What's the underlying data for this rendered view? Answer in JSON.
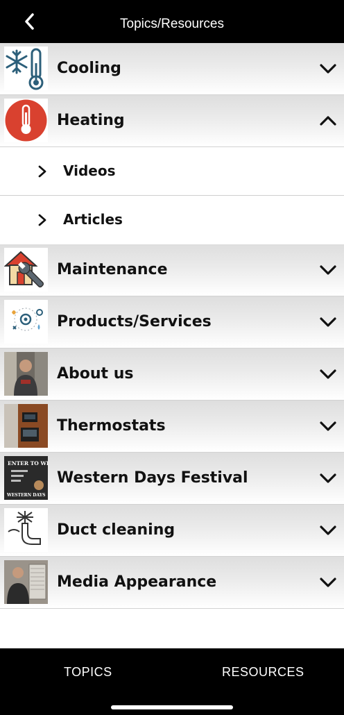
{
  "header": {
    "title": "Topics/Resources",
    "back_icon": "chevron-left-icon"
  },
  "topics": [
    {
      "key": "cooling",
      "label": "Cooling",
      "thumb": "snowflake-thermometer-icon",
      "expanded": false
    },
    {
      "key": "heating",
      "label": "Heating",
      "thumb": "thermometer-icon",
      "expanded": true,
      "children": [
        {
          "label": "Videos"
        },
        {
          "label": "Articles"
        }
      ]
    },
    {
      "key": "maintenance",
      "label": "Maintenance",
      "thumb": "house-wrench-icon",
      "expanded": false
    },
    {
      "key": "products",
      "label": "Products/Services",
      "thumb": "gear-cycle-icon",
      "expanded": false
    },
    {
      "key": "about",
      "label": "About us",
      "thumb": "technician-photo",
      "expanded": false
    },
    {
      "key": "thermostats",
      "label": "Thermostats",
      "thumb": "thermostat-photo",
      "expanded": false
    },
    {
      "key": "western",
      "label": "Western Days Festival",
      "thumb": "enter-to-win-photo",
      "expanded": false,
      "thumb_text": [
        "ENTER TO WIN",
        "WESTERN DAYS"
      ]
    },
    {
      "key": "duct",
      "label": "Duct cleaning",
      "thumb": "duct-brush-icon",
      "expanded": false
    },
    {
      "key": "media",
      "label": "Media Appearance",
      "thumb": "media-photo",
      "expanded": false
    }
  ],
  "tabs": {
    "topics": "TOPICS",
    "resources": "RESOURCES"
  },
  "colors": {
    "bar": "#000000",
    "row_top": "#dedede",
    "row_bottom": "#ffffff",
    "heating_red": "#d9412f",
    "thermo_blue": "#2c5f7a"
  }
}
